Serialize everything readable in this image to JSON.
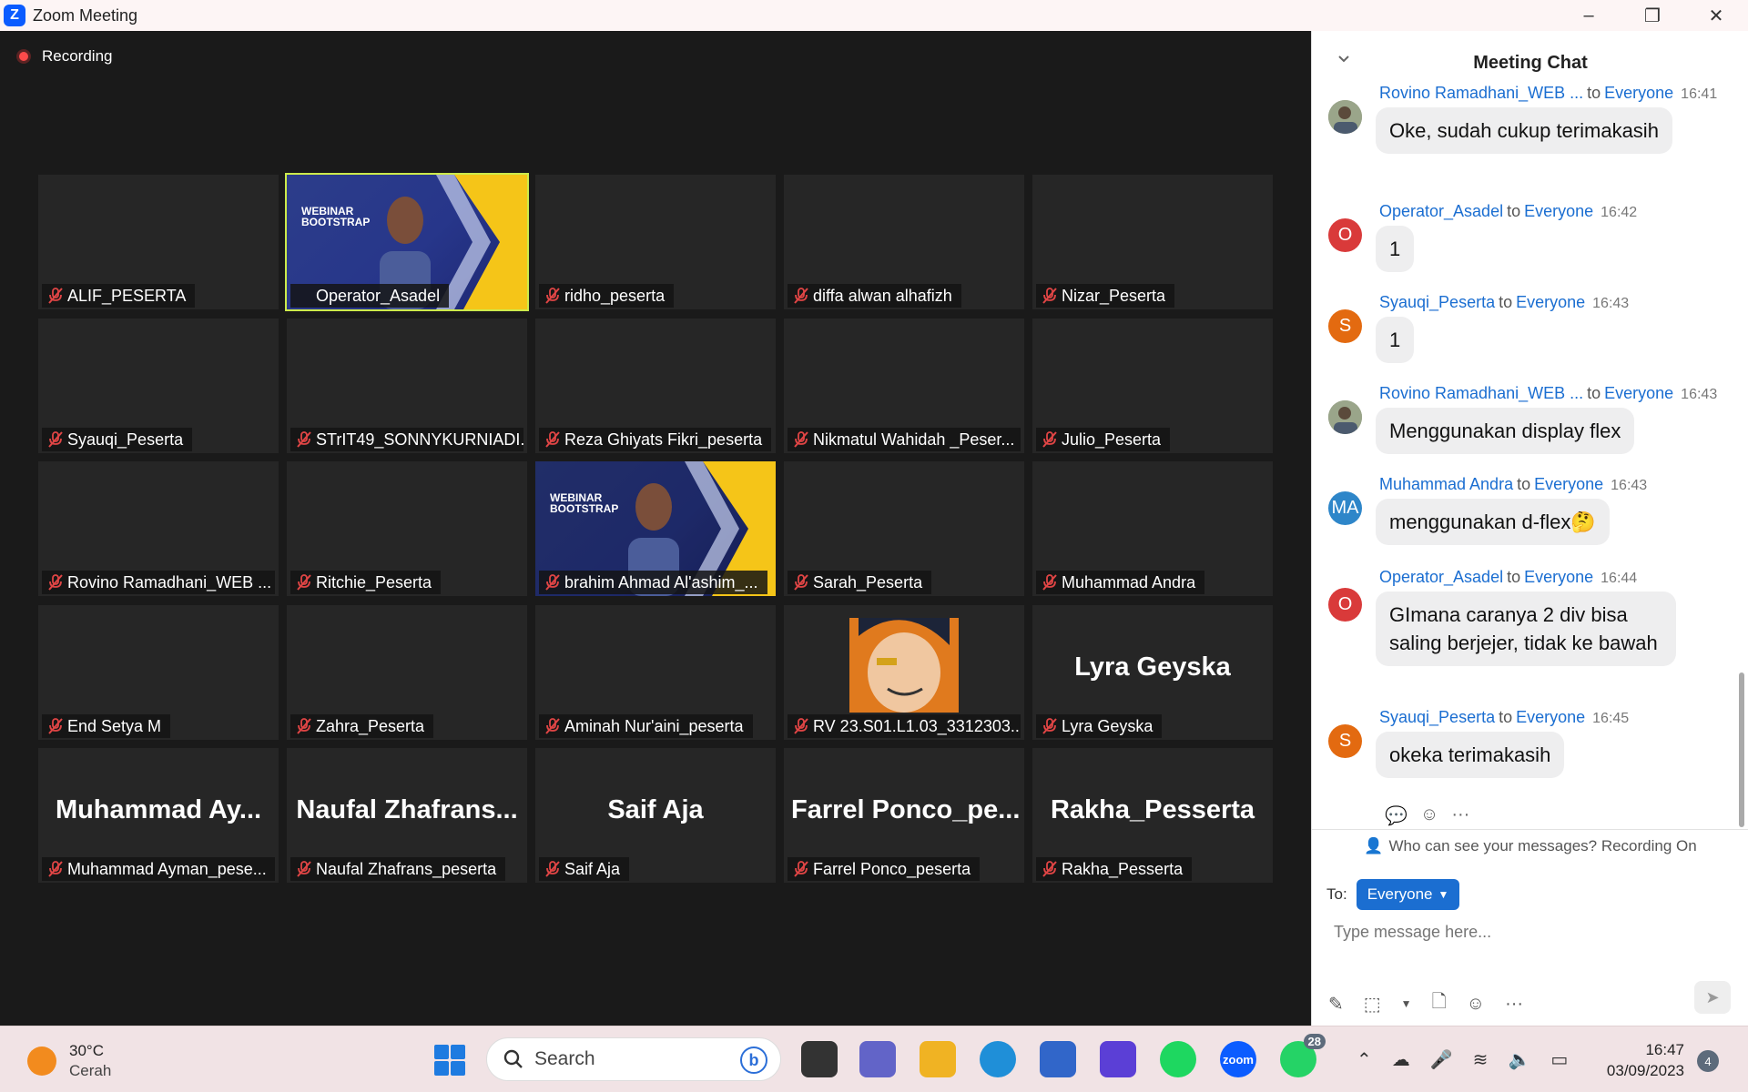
{
  "window": {
    "title": "Zoom Meeting",
    "minimize": "–",
    "maximize": "❐",
    "close": "✕"
  },
  "recording": {
    "label": "Recording",
    "color": "#ff4a4a"
  },
  "accent": {
    "active_speaker": "#cdea4b",
    "zoom_blue": "#0b5cff",
    "link": "#1b6ed1"
  },
  "video_grid": [
    {
      "name": "ALIF_PESERTA",
      "display": "",
      "video": "none",
      "muted": true
    },
    {
      "name": "Operator_Asadel",
      "display": "",
      "video": "webinar-speaker",
      "muted": false,
      "active": true
    },
    {
      "name": "ridho_peserta",
      "display": "",
      "video": "none",
      "muted": true
    },
    {
      "name": "diffa alwan alhafizh",
      "display": "",
      "video": "none",
      "muted": true
    },
    {
      "name": "Nizar_Peserta",
      "display": "",
      "video": "none",
      "muted": true
    },
    {
      "name": "Syauqi_Peserta",
      "display": "",
      "video": "none",
      "muted": true
    },
    {
      "name": "STrIT49_SONNYKURNIADI...",
      "display": "",
      "video": "none",
      "muted": true
    },
    {
      "name": "Reza Ghiyats Fikri_peserta",
      "display": "",
      "video": "none",
      "muted": true
    },
    {
      "name": "Nikmatul Wahidah _Peser...",
      "display": "",
      "video": "none",
      "muted": true
    },
    {
      "name": "Julio_Peserta",
      "display": "",
      "video": "none",
      "muted": true
    },
    {
      "name": "Rovino Ramadhani_WEB ...",
      "display": "",
      "video": "none",
      "muted": true
    },
    {
      "name": "Ritchie_Peserta",
      "display": "",
      "video": "none",
      "muted": true
    },
    {
      "name": "brahim Ahmad Al'ashim_...",
      "display": "",
      "video": "webinar-dark",
      "muted": true
    },
    {
      "name": "Sarah_Peserta",
      "display": "",
      "video": "none",
      "muted": true
    },
    {
      "name": "Muhammad Andra",
      "display": "",
      "video": "none",
      "muted": true
    },
    {
      "name": "End Setya M",
      "display": "",
      "video": "none",
      "muted": true
    },
    {
      "name": "Zahra_Peserta",
      "display": "",
      "video": "none",
      "muted": true
    },
    {
      "name": "Aminah Nur'aini_peserta",
      "display": "",
      "video": "none",
      "muted": true
    },
    {
      "name": "RV 23.S01.L1.03_3312303...",
      "display": "",
      "video": "profile-picture",
      "muted": true
    },
    {
      "name": "Lyra Geyska",
      "display": "Lyra Geyska",
      "video": "none",
      "muted": true
    },
    {
      "name": "Muhammad Ayman_pese...",
      "display": "Muhammad  Ay...",
      "video": "none",
      "muted": true
    },
    {
      "name": "Naufal Zhafrans_peserta",
      "display": "Naufal  Zhafrans...",
      "video": "none",
      "muted": true
    },
    {
      "name": "Saif Aja",
      "display": "Saif Aja",
      "video": "none",
      "muted": true
    },
    {
      "name": "Farrel Ponco_peserta",
      "display": "Farrel  Ponco_pe...",
      "video": "none",
      "muted": true
    },
    {
      "name": "Rakha_Pesserta",
      "display": "Rakha_Pesserta",
      "video": "none",
      "muted": true
    }
  ],
  "video_text": {
    "webinar_line1": "WEBINAR",
    "webinar_line2": "BOOTSTRAP"
  },
  "chat": {
    "title": "Meeting Chat",
    "messages": [
      {
        "sender": "Rovino Ramadhani_WEB ...",
        "to": "to",
        "recipient": "Everyone",
        "time": "16:41",
        "text": "Oke, sudah cukup terimakasih",
        "avatar": "photo",
        "avatar_text": "",
        "avatar_color": "#7d8a6a"
      },
      {
        "sender": "Operator_Asadel",
        "to": "to",
        "recipient": "Everyone",
        "time": "16:42",
        "text": "1",
        "avatar": "initial",
        "avatar_text": "O",
        "avatar_color": "#d93a3a"
      },
      {
        "sender": "Syauqi_Peserta",
        "to": "to",
        "recipient": "Everyone",
        "time": "16:43",
        "text": "1",
        "avatar": "initial",
        "avatar_text": "S",
        "avatar_color": "#e36a10"
      },
      {
        "sender": "Rovino Ramadhani_WEB ...",
        "to": "to",
        "recipient": "Everyone",
        "time": "16:43",
        "text": "Menggunakan display flex",
        "avatar": "photo",
        "avatar_text": "",
        "avatar_color": "#7d8a6a"
      },
      {
        "sender": "Muhammad Andra",
        "to": "to",
        "recipient": "Everyone",
        "time": "16:43",
        "text": "menggunakan d-flex🤔",
        "avatar": "initial",
        "avatar_text": "MA",
        "avatar_color": "#2e86c9"
      },
      {
        "sender": "Operator_Asadel",
        "to": "to",
        "recipient": "Everyone",
        "time": "16:44",
        "text": "GImana caranya 2 div bisa saling berjejer, tidak ke bawah",
        "avatar": "initial",
        "avatar_text": "O",
        "avatar_color": "#d93a3a"
      },
      {
        "sender": "Syauqi_Peserta",
        "to": "to",
        "recipient": "Everyone",
        "time": "16:45",
        "text": "okeka terimakasih",
        "avatar": "initial",
        "avatar_text": "S",
        "avatar_color": "#e36a10"
      }
    ],
    "visibility_note": "Who can see your messages? Recording On",
    "to_label": "To:",
    "recipient_button": "Everyone",
    "input_placeholder": "Type message here..."
  },
  "taskbar": {
    "weather": {
      "temp": "30°C",
      "condition": "Cerah"
    },
    "search_label": "Search",
    "whatsapp_badge": "28",
    "zoom_icon_label": "zoom",
    "clock": {
      "time": "16:47",
      "date": "03/09/2023"
    },
    "notification_count": "4"
  }
}
